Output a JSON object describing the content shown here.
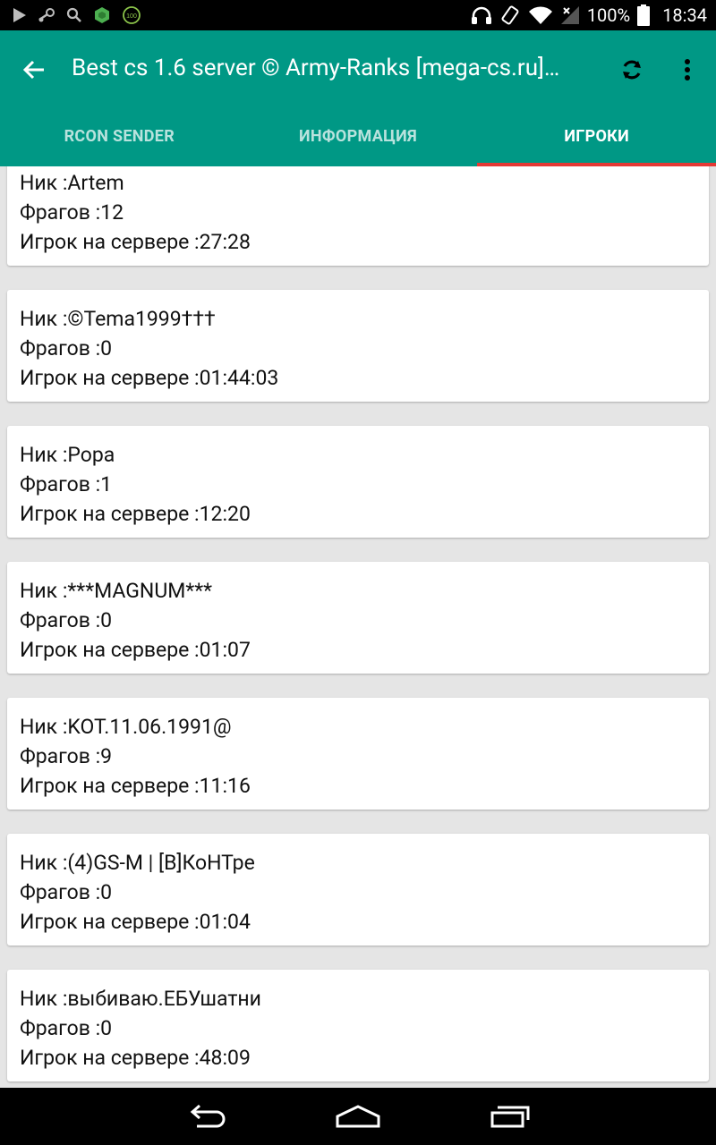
{
  "status_bar": {
    "battery_percent": "100%",
    "time": "18:34",
    "icons": [
      "play-store-icon",
      "steam-icon",
      "search-icon",
      "game-icon",
      "badge-100-icon",
      "headphones-icon",
      "rotate-icon",
      "wifi-icon",
      "signal-icon",
      "battery-icon"
    ],
    "badge_text": "100"
  },
  "app_bar": {
    "title": "Best cs 1.6 server © Army-Ranks [mega-cs.ru]…",
    "background": "#009885",
    "tab_indicator_color": "#e53935"
  },
  "tabs": [
    {
      "label": "RCON SENDER",
      "active": false
    },
    {
      "label": "ИНФОРМАЦИЯ",
      "active": false
    },
    {
      "label": "ИГРОКИ",
      "active": true
    }
  ],
  "players": [
    {
      "nick": "Ник :Artem",
      "frags": "Фрагов :12",
      "time": "Игрок на сервере :27:28"
    },
    {
      "nick": "Ник :©Tema1999†††",
      "frags": "Фрагов :0",
      "time": "Игрок на сервере :01:44:03"
    },
    {
      "nick": "Ник :Popa",
      "frags": "Фрагов :1",
      "time": "Игрок на сервере :12:20"
    },
    {
      "nick": "Ник :***MAGNUM***",
      "frags": "Фрагов :0",
      "time": "Игрок на сервере :01:07"
    },
    {
      "nick": "Ник :KOT.11.06.1991@",
      "frags": "Фрагов :9",
      "time": "Игрок на сервере :11:16"
    },
    {
      "nick": "Ник :(4)GS-M | [B]КоНТре",
      "frags": "Фрагов :0",
      "time": "Игрок на сервере :01:04"
    },
    {
      "nick": "Ник :выбиваю.ЕБУшатни",
      "frags": "Фрагов :0",
      "time": "Игрок на сервере :48:09"
    }
  ]
}
